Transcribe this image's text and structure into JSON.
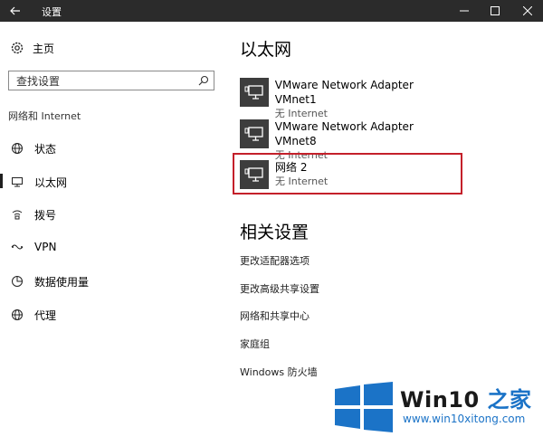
{
  "titlebar": {
    "title": "设置"
  },
  "sidebar": {
    "home_label": "主页",
    "search_placeholder": "查找设置",
    "section_label": "网络和 Internet",
    "items": [
      {
        "label": "状态",
        "icon": "globe-status-icon"
      },
      {
        "label": "以太网",
        "icon": "ethernet-icon",
        "active": true
      },
      {
        "label": "拨号",
        "icon": "dialup-icon"
      },
      {
        "label": "VPN",
        "icon": "vpn-icon"
      },
      {
        "label": "数据使用量",
        "icon": "data-usage-icon"
      },
      {
        "label": "代理",
        "icon": "proxy-globe-icon"
      }
    ]
  },
  "main": {
    "title": "以太网",
    "adapters": [
      {
        "name": "VMware Network Adapter VMnet1",
        "status": "无 Internet"
      },
      {
        "name": "VMware Network Adapter VMnet8",
        "status": "无 Internet"
      },
      {
        "name": "网络  2",
        "status": "无 Internet",
        "highlighted": true
      }
    ],
    "related_title": "相关设置",
    "related_links": [
      "更改适配器选项",
      "更改高级共享设置",
      "网络和共享中心",
      "家庭组",
      "Windows 防火墙"
    ]
  },
  "watermark": {
    "title_part1": "Win10",
    "title_part2": "之家",
    "url": "www.win10xitong.com"
  },
  "colors": {
    "titlebar": "#2b2b2b",
    "highlight": "#c4202a",
    "tile": "#3d3d3d",
    "brand_blue": "#1b73c7"
  }
}
